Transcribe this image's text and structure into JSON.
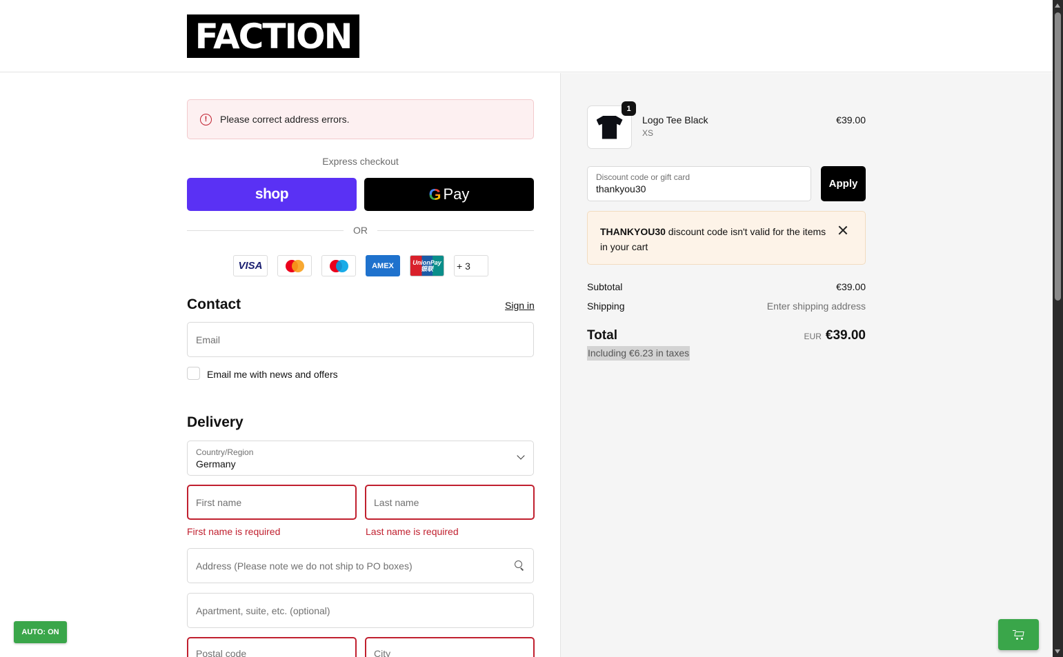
{
  "brand": {
    "logo_text": "FACTION"
  },
  "alert": {
    "message": "Please correct address errors."
  },
  "express": {
    "label": "Express checkout",
    "shop_label": "shop",
    "gpay_g": "G",
    "gpay_label": "Pay",
    "or_label": "OR"
  },
  "payment_cards": {
    "visa": "VISA",
    "amex": "AMEX",
    "unionpay_top": "UnionPay",
    "unionpay_bottom": "银联",
    "more": "+ 3"
  },
  "contact": {
    "title": "Contact",
    "sign_in": "Sign in",
    "email_placeholder": "Email",
    "newsletter_label": "Email me with news and offers"
  },
  "delivery": {
    "title": "Delivery",
    "country_label": "Country/Region",
    "country_value": "Germany",
    "first_name_placeholder": "First name",
    "last_name_placeholder": "Last name",
    "first_name_error": "First name is required",
    "last_name_error": "Last name is required",
    "address_placeholder": "Address (Please note we do not ship to PO boxes)",
    "apartment_placeholder": "Apartment, suite, etc. (optional)",
    "postal_placeholder": "Postal code",
    "city_placeholder": "City"
  },
  "auto_badge": "AUTO: ON",
  "summary": {
    "product": {
      "name": "Logo Tee Black",
      "variant": "XS",
      "price": "€39.00",
      "quantity": "1"
    },
    "discount": {
      "label": "Discount code or gift card",
      "value": "thankyou30",
      "apply_label": "Apply",
      "warning_code": "THANKYOU30",
      "warning_text": " discount code isn't valid for the items in your cart"
    },
    "subtotal_label": "Subtotal",
    "subtotal_value": "€39.00",
    "shipping_label": "Shipping",
    "shipping_value": "Enter shipping address",
    "total_label": "Total",
    "total_currency": "EUR",
    "total_value": "€39.00",
    "tax_note": "Including €6.23 in taxes"
  },
  "colors": {
    "shop_pay": "#5a31f4",
    "error": "#c01f2e",
    "accent_green": "#3aa64a"
  }
}
